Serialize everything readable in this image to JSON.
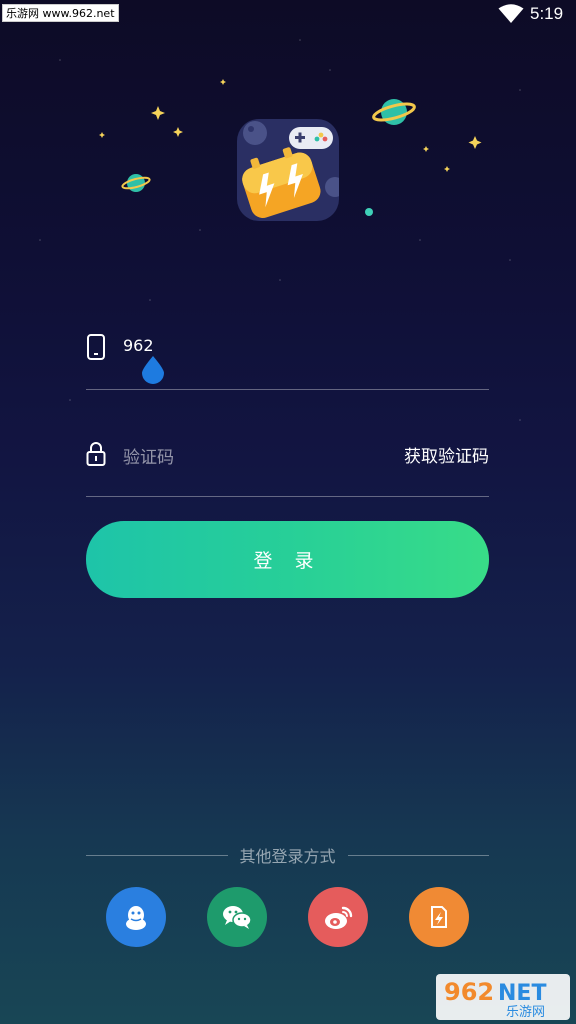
{
  "status_bar": {
    "watermark": "乐游网 www.962.net",
    "time": "5:19",
    "icons": [
      "wifi-icon"
    ]
  },
  "app": {
    "logo": "game-controller-bolt-logo"
  },
  "form": {
    "phone_value": "962",
    "code_placeholder": "验证码",
    "get_code_label": "获取验证码",
    "login_label": "登 录"
  },
  "other_login": {
    "label": "其他登录方式",
    "providers": [
      {
        "name": "qq",
        "icon": "qq-penguin-icon",
        "color": "#2a7fe0"
      },
      {
        "name": "wechat",
        "icon": "wechat-icon",
        "color": "#1e9b6c"
      },
      {
        "name": "weibo",
        "icon": "weibo-icon",
        "color": "#e55c5c"
      },
      {
        "name": "other",
        "icon": "lightning-card-icon",
        "color": "#f08a34"
      }
    ]
  },
  "watermark_bottom": {
    "brand": "962NET",
    "sub": "乐游网"
  },
  "colors": {
    "accent_start": "#1ec4a9",
    "accent_end": "#38dc88"
  }
}
